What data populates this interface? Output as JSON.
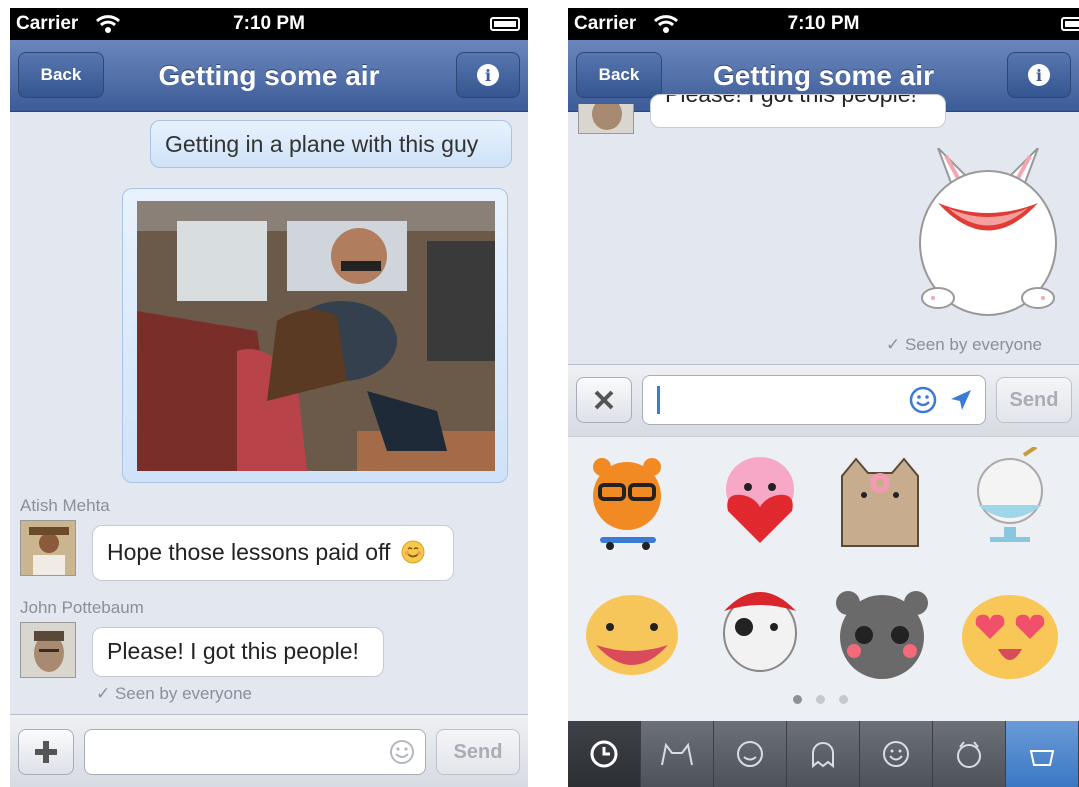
{
  "left_screen": {
    "status": {
      "carrier": "Carrier",
      "time": "7:10 PM"
    },
    "nav": {
      "back": "Back",
      "title": "Getting some air",
      "info": "i"
    },
    "messages": [
      {
        "type": "text_out",
        "text": "Getting in a plane with this guy"
      },
      {
        "type": "photo_out",
        "description": "photo"
      }
    ],
    "incoming": [
      {
        "sender": "Atish Mehta",
        "text": "Hope those lessons paid off",
        "emoji": "smile"
      },
      {
        "sender": "John Pottebaum",
        "text": "Please! I got this people!"
      }
    ],
    "seen": "✓ Seen by everyone",
    "composer": {
      "plus": "+",
      "send": "Send",
      "placeholder": ""
    }
  },
  "right_screen": {
    "status": {
      "carrier": "Carrier",
      "time": "7:10 PM"
    },
    "nav": {
      "back": "Back",
      "title": "Getting some air",
      "info": "i"
    },
    "partial_message": "Please! I got this people!",
    "seen": "✓ Seen by everyone",
    "composer": {
      "close": "✕",
      "send": "Send"
    },
    "stickers": [
      "tiger-skateboard",
      "pink-heart-monster",
      "pusheen-cat",
      "bunny-bowl",
      "yellow-blob",
      "pirate-cat",
      "grey-hamster",
      "heart-eyes-face"
    ],
    "page_dots": 3,
    "active_page": 0,
    "tabs": [
      "clock",
      "cat-outline",
      "smiley-round",
      "ghost",
      "happy-face",
      "creature",
      "basket"
    ]
  },
  "colors": {
    "nav": "#3c5c98",
    "bubble_out": "#d7e7fa",
    "bg": "#e3e8f0"
  }
}
